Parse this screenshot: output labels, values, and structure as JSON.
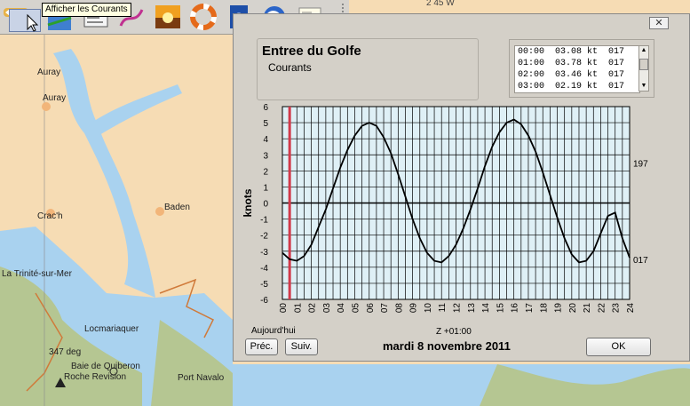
{
  "toolbar": {
    "tooltip": "Afficher les Courants",
    "buttons": [
      {
        "name": "navigation-arrow-button-icon"
      },
      {
        "name": "tide-height-button-icon"
      },
      {
        "name": "instrument-panel-button-icon"
      },
      {
        "name": "route-button-icon"
      },
      {
        "name": "sunset-button-icon"
      },
      {
        "name": "lifebuoy-button-icon"
      },
      {
        "name": "help-book-button-icon"
      },
      {
        "name": "earth-globe-button-icon"
      },
      {
        "name": "certificate-button-icon"
      }
    ]
  },
  "map": {
    "labels": [
      "Auray",
      "Auray",
      "Baden",
      "Crac'h",
      "La Trinité-sur-Mer",
      "Locmariaquer",
      "347 deg",
      "Baie de Quiberon",
      "Roche Revision",
      "Port Navalo",
      "2 45 W"
    ],
    "colors": {
      "land": "#f6dcb4",
      "water": "#a9d2ef",
      "shallow": "#b5c692",
      "deep": "#ffffff"
    }
  },
  "dialog": {
    "close_label": "✕",
    "station_name": "Entree du Golfe",
    "station_type": "Courants",
    "list_rows": [
      "00:00  03.08 kt  017",
      "01:00  03.78 kt  017",
      "02:00  03.46 kt  017",
      "03:00  02.19 kt  017"
    ],
    "today_label": "Aujourd'hui",
    "timezone_label": "Z +01:00",
    "date_label": "mardi 8 novembre 2011",
    "prev_label": "Préc.",
    "next_label": "Suiv.",
    "ok_label": "OK"
  },
  "chart_data": {
    "type": "line",
    "ylabel": "knots",
    "ylim": [
      -6,
      6
    ],
    "yticks": [
      6,
      5,
      4,
      3,
      2,
      1,
      0,
      -1,
      -2,
      -3,
      -4,
      -5,
      -6
    ],
    "xlim": [
      0,
      24
    ],
    "xticks": [
      "00",
      "01",
      "02",
      "03",
      "04",
      "05",
      "06",
      "07",
      "08",
      "09",
      "10",
      "11",
      "12",
      "13",
      "14",
      "15",
      "16",
      "17",
      "18",
      "19",
      "20",
      "21",
      "22",
      "23",
      "24"
    ],
    "right_labels": [
      {
        "text": "197",
        "y": 2.5
      },
      {
        "text": "017",
        "y": -3.5
      }
    ],
    "current_time": 0.5,
    "colors": {
      "background": "#dff0f6",
      "grid": "#000000",
      "curve": "#000000",
      "marker": "#d23a4b"
    },
    "series": [
      {
        "x": [
          0,
          0.5,
          1,
          1.5,
          2,
          2.5,
          3,
          3.5,
          4,
          4.5,
          5,
          5.5,
          6,
          6.5,
          7,
          7.5,
          8,
          8.5,
          9,
          9.5,
          10,
          10.5,
          11,
          11.5,
          12,
          12.5,
          13,
          13.5,
          14,
          14.5,
          15,
          15.5,
          16,
          16.5,
          17,
          17.5,
          18,
          18.5,
          19,
          19.5,
          20,
          20.5,
          21,
          21.5,
          22,
          22.5,
          23,
          23.5,
          24
        ],
        "y": [
          -3.1,
          -3.5,
          -3.6,
          -3.3,
          -2.6,
          -1.5,
          -0.4,
          0.9,
          2.2,
          3.3,
          4.2,
          4.8,
          5.0,
          4.8,
          4.1,
          3.1,
          1.8,
          0.4,
          -1.0,
          -2.2,
          -3.1,
          -3.6,
          -3.7,
          -3.3,
          -2.6,
          -1.6,
          -0.4,
          0.9,
          2.3,
          3.5,
          4.4,
          5.0,
          5.2,
          4.9,
          4.2,
          3.2,
          1.9,
          0.5,
          -0.9,
          -2.2,
          -3.2,
          -3.7,
          -3.6,
          -3.0,
          -1.9,
          -0.8,
          -0.6,
          -2.2,
          -3.4
        ]
      }
    ]
  }
}
